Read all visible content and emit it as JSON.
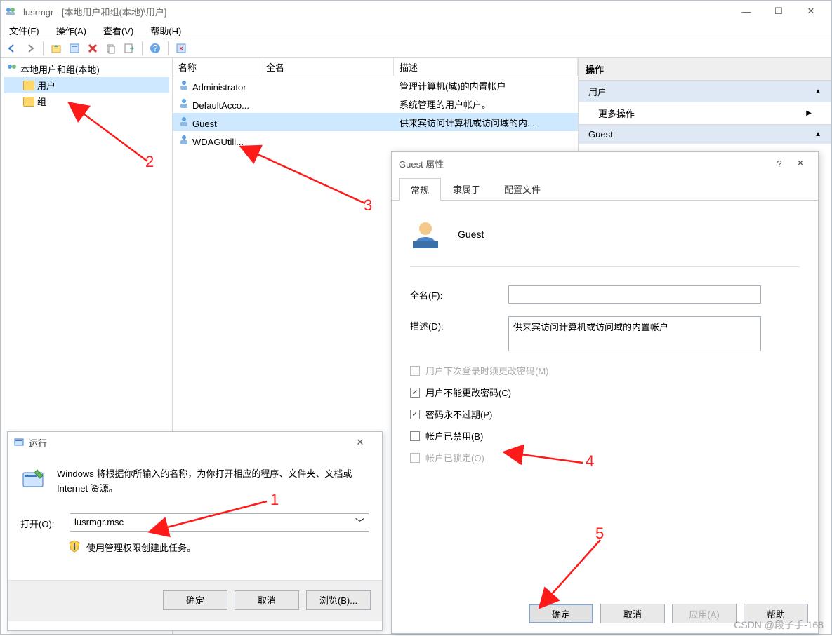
{
  "mmc": {
    "title": "lusrmgr - [本地用户和组(本地)\\用户]",
    "menu": {
      "file": "文件(F)",
      "action": "操作(A)",
      "view": "查看(V)",
      "help": "帮助(H)"
    },
    "tree": {
      "root": "本地用户和组(本地)",
      "users": "用户",
      "groups": "组"
    },
    "list": {
      "headers": {
        "name": "名称",
        "fullname": "全名",
        "desc": "描述"
      },
      "rows": [
        {
          "name": "Administrator",
          "full": "",
          "desc": "管理计算机(域)的内置帐户"
        },
        {
          "name": "DefaultAcco...",
          "full": "",
          "desc": "系统管理的用户帐户。"
        },
        {
          "name": "Guest",
          "full": "",
          "desc": "供来宾访问计算机或访问域的内..."
        },
        {
          "name": "WDAGUtili...",
          "full": "",
          "desc": ""
        }
      ]
    },
    "actions": {
      "title": "操作",
      "section1": "用户",
      "more": "更多操作",
      "section2": "Guest"
    }
  },
  "run": {
    "title": "运行",
    "msg": "Windows 将根据你所输入的名称，为你打开相应的程序、文件夹、文档或 Internet 资源。",
    "open_label": "打开(O):",
    "open_value": "lusrmgr.msc",
    "shield_note": "使用管理权限创建此任务。",
    "ok": "确定",
    "cancel": "取消",
    "browse": "浏览(B)..."
  },
  "prop": {
    "title": "Guest 属性",
    "tabs": {
      "general": "常规",
      "member": "隶属于",
      "profile": "配置文件"
    },
    "username": "Guest",
    "fullname_label": "全名(F):",
    "fullname_value": "",
    "desc_label": "描述(D):",
    "desc_value": "供来宾访问计算机或访问域的内置帐户",
    "chk_nextlogin": "用户下次登录时须更改密码(M)",
    "chk_cannotchg": "用户不能更改密码(C)",
    "chk_neverexp": "密码永不过期(P)",
    "chk_disabled": "帐户已禁用(B)",
    "chk_locked": "帐户已锁定(O)",
    "ok": "确定",
    "cancel": "取消",
    "apply": "应用(A)",
    "help": "帮助"
  },
  "anno": {
    "n1": "1",
    "n2": "2",
    "n3": "3",
    "n4": "4",
    "n5": "5"
  },
  "watermark": "CSDN @段子手-168"
}
